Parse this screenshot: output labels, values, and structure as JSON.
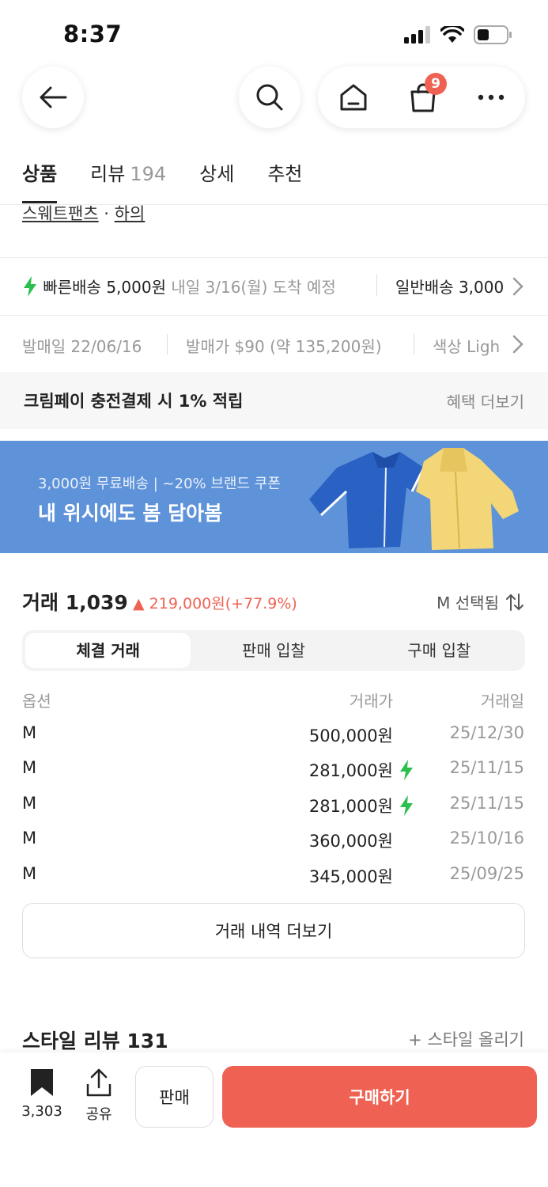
{
  "status": {
    "time": "8:37"
  },
  "nav": {
    "cart_badge": "9"
  },
  "tabs": [
    {
      "label": "상품"
    },
    {
      "label": "리뷰",
      "count": "194"
    },
    {
      "label": "상세"
    },
    {
      "label": "추천"
    }
  ],
  "breadcrumb": {
    "category": "스웨트팬츠",
    "separator": "·",
    "sub": "하의"
  },
  "shipping": {
    "fast_label": "빠른배송 5,000원",
    "fast_eta": "내일 3/16(월) 도착 예정",
    "normal_label": "일반배송 3,000"
  },
  "info": {
    "release_date": "발매일 22/06/16",
    "release_price": "발매가 $90 (약 135,200원)",
    "color": "색상 Ligh"
  },
  "benefit": {
    "text": "크림페이 충전결제 시 1% 적립",
    "link": "혜택 더보기"
  },
  "banner": {
    "sub": "3,000원 무료배송 | ~20% 브랜드 쿠폰",
    "title": "내 위시에도 봄 담아봄"
  },
  "trade": {
    "title": "거래 1,039",
    "change": "219,000원(+77.9%)",
    "selected": "M 선택됨",
    "segments": [
      "체결 거래",
      "판매 입찰",
      "구매 입찰"
    ],
    "columns": {
      "option": "옵션",
      "price": "거래가",
      "date": "거래일"
    },
    "rows": [
      {
        "option": "M",
        "price": "500,000원",
        "date": "25/12/30",
        "fast": false
      },
      {
        "option": "M",
        "price": "281,000원",
        "date": "25/11/15",
        "fast": true
      },
      {
        "option": "M",
        "price": "281,000원",
        "date": "25/11/15",
        "fast": true
      },
      {
        "option": "M",
        "price": "360,000원",
        "date": "25/10/16",
        "fast": false
      },
      {
        "option": "M",
        "price": "345,000원",
        "date": "25/09/25",
        "fast": false
      }
    ],
    "more": "거래 내역 더보기"
  },
  "style_review": {
    "title": "스타일 리뷰 131",
    "add": "+ 스타일 올리기"
  },
  "bottom": {
    "bookmark_count": "3,303",
    "share": "공유",
    "sell": "판매",
    "buy": "구매하기"
  },
  "colors": {
    "accent": "#ef6253",
    "banner": "#5f93d9",
    "fast": "#2bbf4e"
  }
}
